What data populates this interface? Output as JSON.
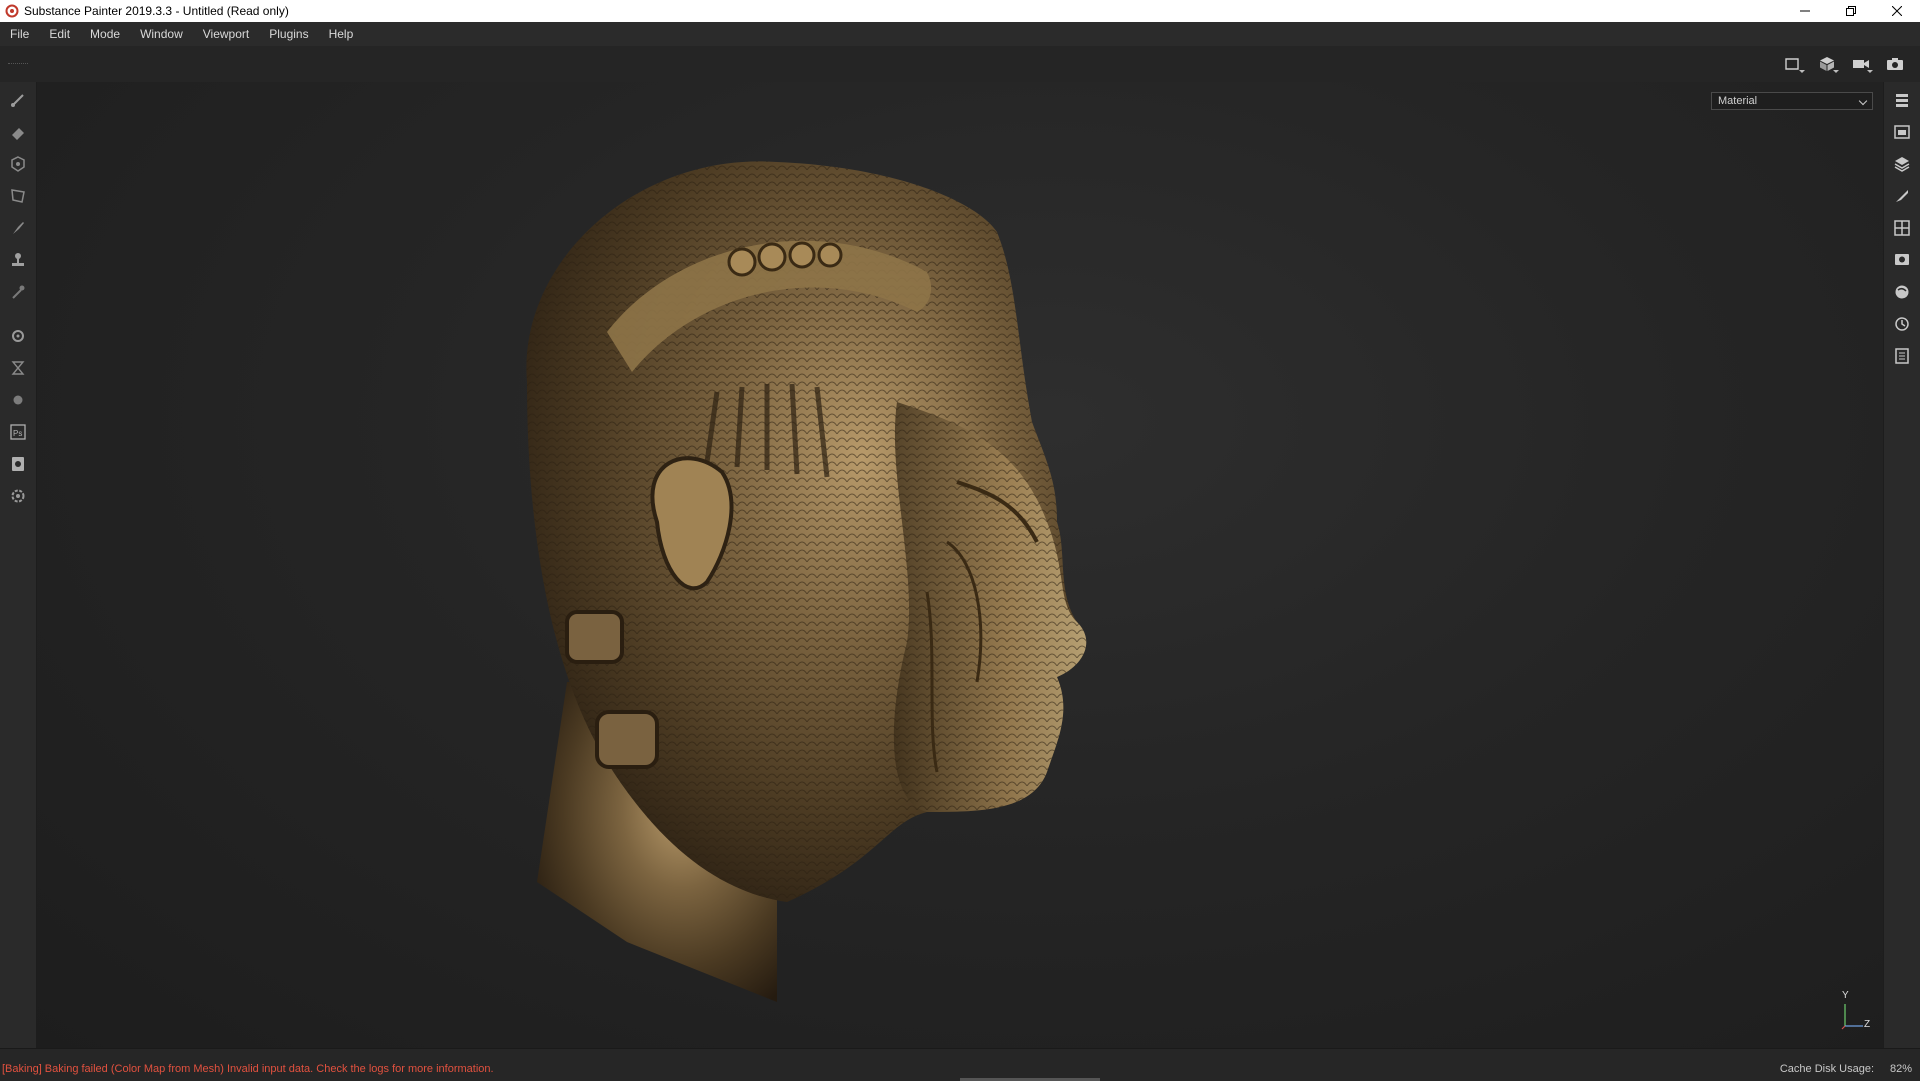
{
  "window": {
    "title": "Substance Painter 2019.3.3 - Untitled (Read only)",
    "app_icon": "substance-painter-logo-icon",
    "controls": [
      "minimize-icon",
      "restore-icon",
      "close-icon"
    ]
  },
  "menu": {
    "items": [
      "File",
      "Edit",
      "Mode",
      "Window",
      "Viewport",
      "Plugins",
      "Help"
    ]
  },
  "top_toolbar": {
    "tools": [
      "2d-view-icon",
      "3d-view-icon",
      "camera-icon",
      "screenshot-icon"
    ]
  },
  "left_toolbar": {
    "tools": [
      "paint-brush-icon",
      "eraser-icon",
      "projection-icon",
      "polygon-fill-icon",
      "smudge-icon",
      "clone-stamp-icon",
      "color-picker-icon",
      "bake-settings-icon",
      "hourglass-icon",
      "material-sphere-icon",
      "photoshop-export-icon",
      "document-export-icon",
      "plugin-gear-icon"
    ]
  },
  "right_toolbar": {
    "tools": [
      "layers-icon",
      "texture-set-icon",
      "stack-icon",
      "brush-properties-icon",
      "display-settings-icon",
      "viewer-settings-icon",
      "shelf-icon",
      "history-icon",
      "log-icon"
    ]
  },
  "viewport": {
    "mode_select_value": "Material",
    "axis": {
      "y": "Y",
      "z": "Z"
    }
  },
  "status": {
    "message": "[Baking] Baking failed (Color Map from Mesh) Invalid input data. Check the logs for more information.",
    "cache_label": "Cache Disk Usage:",
    "cache_value": "82%",
    "error_color": "#e2513f"
  }
}
